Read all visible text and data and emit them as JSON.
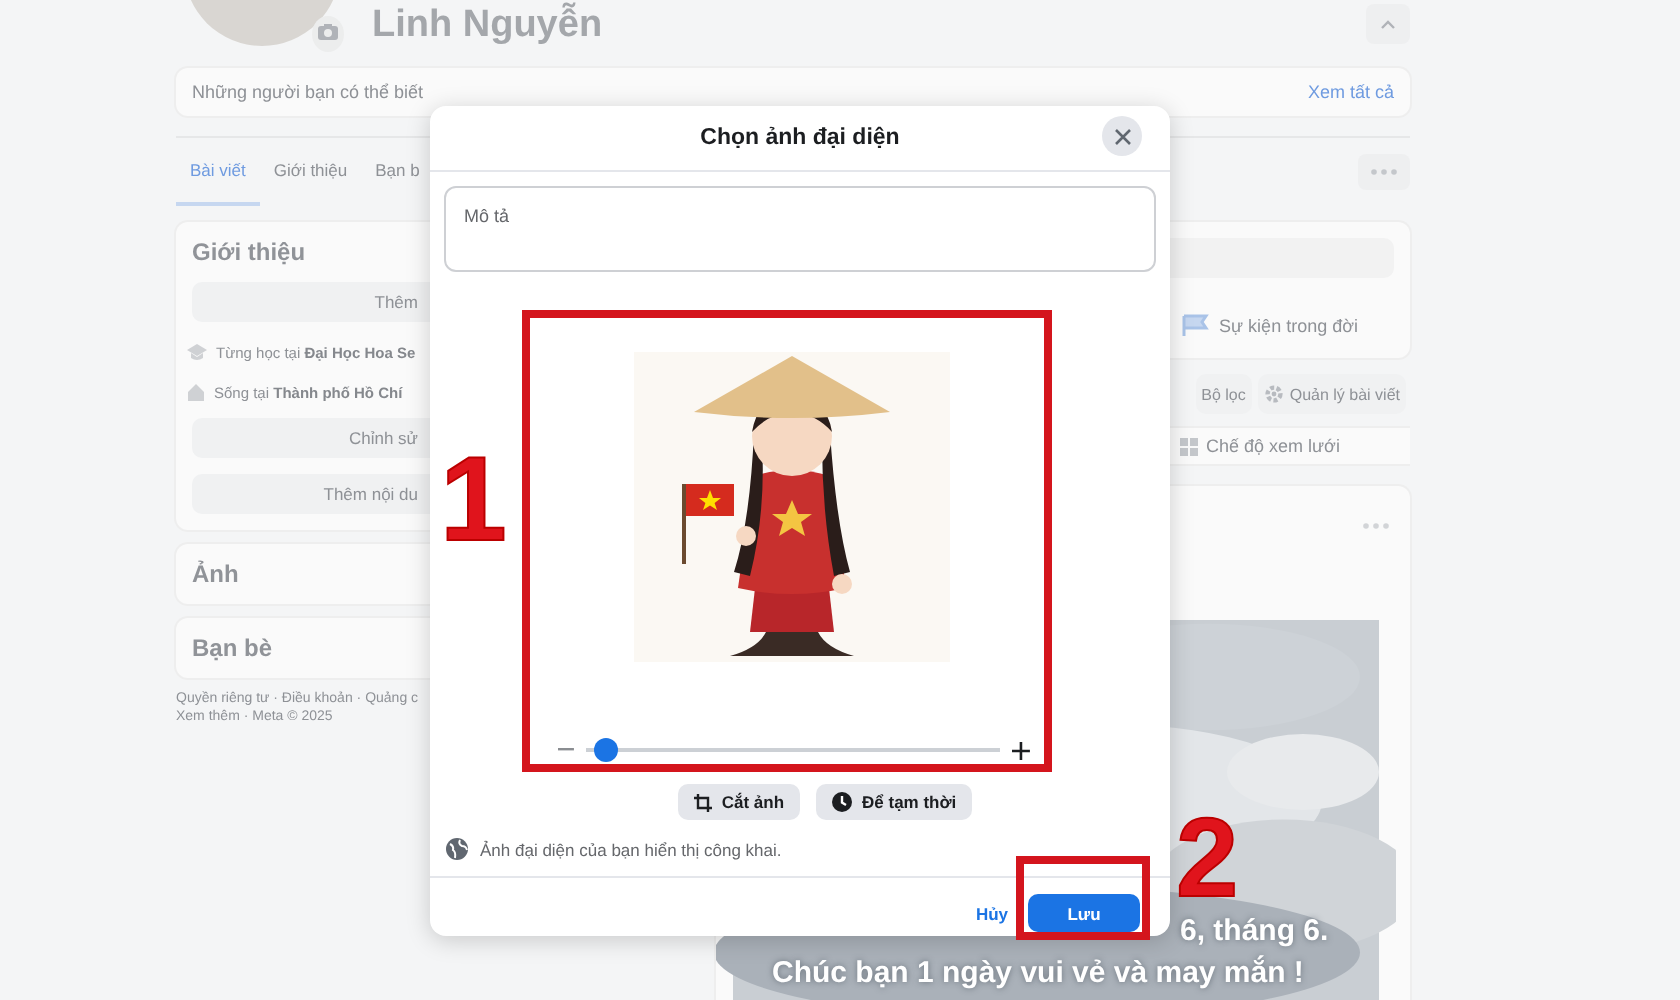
{
  "profile": {
    "name": "Linh Nguyễn"
  },
  "suggestions": {
    "title": "Những người bạn có thể biết",
    "link": "Xem tất cả"
  },
  "profile_tabs": [
    {
      "label": "Bài viết",
      "selected": true
    },
    {
      "label": "Giới thiệu",
      "selected": false
    },
    {
      "label": "Bạn b",
      "selected": false
    }
  ],
  "intro": {
    "title": "Giới thiệu",
    "items": [
      {
        "kind": "button",
        "label": "Thêm"
      },
      {
        "kind": "school",
        "text": "Từng học tại **Đại Học Hoa Se**"
      },
      {
        "kind": "home",
        "text": "Sống tại **Thành phố Hồ Chí**"
      },
      {
        "kind": "button",
        "label": "Chỉnh sử"
      },
      {
        "kind": "button",
        "label": "Thêm nội du"
      }
    ]
  },
  "sections": [
    "Ảnh",
    "Bạn bè"
  ],
  "footer": [
    "Quyền riêng tư · Điều khoản · Quảng c",
    "Xem thêm · Meta © 2025"
  ],
  "life_event": "Sự kiện trong đời",
  "post_tools": [
    "Bộ lọc",
    "Quản lý bài viết"
  ],
  "grid_view": "Chế độ xem lưới",
  "post_captions": [
    "6, tháng 6.",
    "Chúc bạn 1 ngày vui vẻ và may mắn !"
  ],
  "dialog": {
    "title": "Chọn ảnh đại diện",
    "placeholder": "Mô tả",
    "zoom_slider": {
      "level": 0.02
    },
    "actions": [
      {
        "kind": "crop",
        "label": "Cắt ảnh"
      },
      {
        "kind": "temporary",
        "label": "Để tạm thời"
      }
    ],
    "privacy_note": "Ảnh đại diện của bạn hiển thị công khai.",
    "cancel": "Hủy",
    "save": "Lưu"
  },
  "step_marks": [
    "1",
    "2"
  ]
}
